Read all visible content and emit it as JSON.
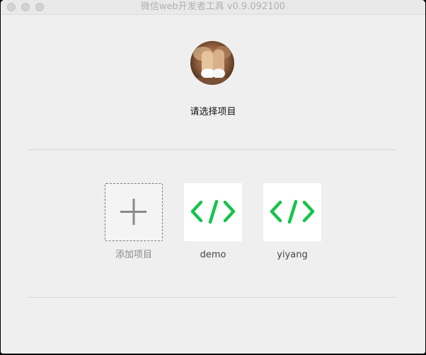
{
  "window": {
    "title": "微信web开发者工具 v0.9.092100"
  },
  "header": {
    "prompt": "请选择项目"
  },
  "projects": {
    "add_label": "添加项目",
    "items": [
      {
        "name": "demo",
        "icon": "code-icon"
      },
      {
        "name": "yiyang",
        "icon": "code-icon"
      }
    ]
  },
  "colors": {
    "accent_green": "#16c34c",
    "window_bg": "#efefef"
  }
}
